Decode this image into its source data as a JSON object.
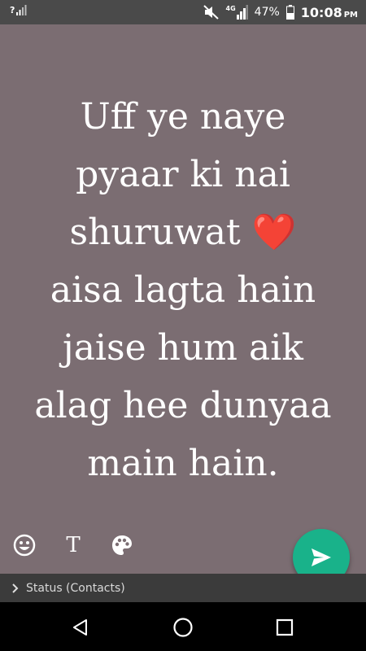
{
  "status_bar": {
    "sim_indicator": "?",
    "network_type": "4G",
    "battery_percent": "47%",
    "time": "10:08",
    "ampm": "PM",
    "icons": [
      "signal-unknown-icon",
      "mute-icon",
      "signal-strength-icon",
      "battery-icon"
    ]
  },
  "composer": {
    "background_color": "#7b6d72",
    "status_text": "Uff ye naye\npyaar ki nai\nshuruwat ❤️\naisa lagta hain\njaise hum aik\nalag hee dunyaa\nmain hain.",
    "tools": [
      "emoji-icon",
      "text-style-icon",
      "palette-icon"
    ],
    "text_tool_label": "T",
    "send_color": "#19b28a"
  },
  "audience": {
    "label": "Status (Contacts)"
  },
  "nav": {
    "buttons": [
      "back-icon",
      "home-icon",
      "recents-icon"
    ]
  }
}
